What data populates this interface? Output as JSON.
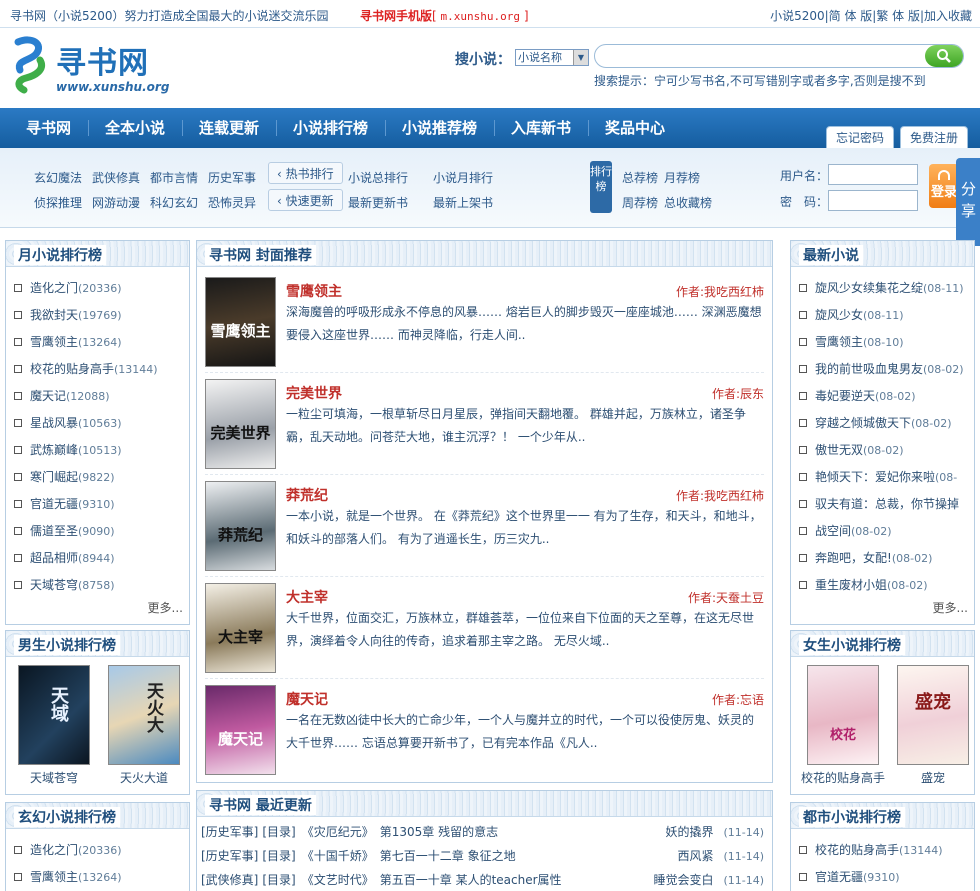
{
  "topbar": {
    "left": "寻书网（小说5200）努力打造成全国最大的小说迷交流乐园",
    "mobile_label": "寻书网手机版",
    "mobile_url": "m.xunshu.org",
    "right": "小说5200|简 体 版|繁 体 版|加入收藏"
  },
  "logo": {
    "name": "寻书网",
    "url": "www.xunshu.org"
  },
  "search": {
    "label": "搜小说：",
    "select": "小说名称",
    "button": "搜",
    "tip": "搜索提示：宁可少写书名,不可写错别字或者多字,否则是搜不到"
  },
  "nav": [
    "寻书网",
    "全本小说",
    "连载更新",
    "小说排行榜",
    "小说推荐榜",
    "入库新书",
    "奖品中心"
  ],
  "nav_tabs": [
    "忘记密码",
    "免费注册"
  ],
  "subnav": {
    "genres_row1": [
      "玄幻魔法",
      "武侠修真",
      "都市言情",
      "历史军事"
    ],
    "genres_row2": [
      "侦探推理",
      "网游动漫",
      "科幻玄幻",
      "恐怖灵异"
    ],
    "hot": "热书排行",
    "fast": "快速更新",
    "row1": [
      "小说总排行",
      "小说月排行"
    ],
    "row2": [
      "最新更新书",
      "最新上架书"
    ],
    "badge": "排行榜",
    "rank_row1": [
      "总荐榜",
      "月荐榜"
    ],
    "rank_row2": [
      "周荐榜",
      "总收藏榜"
    ]
  },
  "login": {
    "user_label": "用户名：",
    "pass_label": "密　码：",
    "button": "登录",
    "share": "分享"
  },
  "month_rank": {
    "title": "月小说排行榜",
    "items": [
      [
        "造化之门",
        "(20336)"
      ],
      [
        "我欲封天",
        "(19769)"
      ],
      [
        "雪鹰领主",
        "(13264)"
      ],
      [
        "校花的贴身高手",
        "(13144)"
      ],
      [
        "魔天记",
        "(12088)"
      ],
      [
        "星战风暴",
        "(10563)"
      ],
      [
        "武炼巅峰",
        "(10513)"
      ],
      [
        "寒门崛起",
        "(9822)"
      ],
      [
        "官道无疆",
        "(9310)"
      ],
      [
        "儒道至圣",
        "(9090)"
      ],
      [
        "超品相师",
        "(8944)"
      ],
      [
        "天域苍穹",
        "(8758)"
      ]
    ],
    "more": "更多..."
  },
  "male_rank": {
    "title": "男生小说排行榜",
    "books": [
      "天域苍穹",
      "天火大道"
    ]
  },
  "xuanhuan_rank": {
    "title": "玄幻小说排行榜",
    "items": [
      [
        "造化之门",
        "(20336)"
      ],
      [
        "雪鹰领主",
        "(13264)"
      ]
    ]
  },
  "featured": {
    "title": "寻书网 封面推荐",
    "books": [
      {
        "title": "雪鹰领主",
        "author": "作者:我吃西红柿",
        "desc": "深海魔兽的呼吸形成永不停息的风暴…… 熔岩巨人的脚步毁灭一座座城池…… 深渊恶魔想要侵入这座世界…… 而神灵降临，行走人间..",
        "cover": "雪鹰领主"
      },
      {
        "title": "完美世界",
        "author": "作者:辰东",
        "desc": "一粒尘可填海，一根草斩尽日月星辰，弹指间天翻地覆。 群雄并起，万族林立，诸圣争霸，乱天动地。问苍茫大地，谁主沉浮？！ 一个少年从..",
        "cover": "完美世界"
      },
      {
        "title": "莽荒纪",
        "author": "作者:我吃西红柿",
        "desc": "一本小说，就是一个世界。 在《莽荒纪》这个世界里一一 有为了生存，和天斗，和地斗，和妖斗的部落人们。 有为了逍遥长生，历三灾九..",
        "cover": "莽荒纪"
      },
      {
        "title": "大主宰",
        "author": "作者:天蚕土豆",
        "desc": "大千世界，位面交汇，万族林立，群雄荟萃，一位位来自下位面的天之至尊，在这无尽世界，演绎着令人向往的传奇，追求着那主宰之路。 无尽火域..",
        "cover": "大主宰"
      },
      {
        "title": "魔天记",
        "author": "作者:忘语",
        "desc": "一名在无数凶徒中长大的亡命少年，一个人与魔并立的时代，一个可以役使厉鬼、妖灵的大千世界…… 忘语总算要开新书了，已有完本作品《凡人..",
        "cover": "魔天记"
      }
    ]
  },
  "recent": {
    "title": "寻书网 最近更新",
    "rows": [
      {
        "cat": "[历史军事]",
        "dir": "[目录]",
        "book": "《灾厄纪元》",
        "chapter": "第1305章 残留的意志",
        "author": "妖的撬界",
        "date": "(11-14)"
      },
      {
        "cat": "[历史军事]",
        "dir": "[目录]",
        "book": "《十国千娇》",
        "chapter": "第七百一十二章 象征之地",
        "author": "西风紧",
        "date": "(11-14)"
      },
      {
        "cat": "[武侠修真]",
        "dir": "[目录]",
        "book": "《文艺时代》",
        "chapter": "第五百一十章 某人的teacher属性",
        "author": "睡觉会变白",
        "date": "(11-14)"
      }
    ]
  },
  "newest": {
    "title": "最新小说",
    "items": [
      [
        "旋风少女续集花之绽",
        "(08-11)"
      ],
      [
        "旋风少女",
        "(08-11)"
      ],
      [
        "雪鹰领主",
        "(08-10)"
      ],
      [
        "我的前世吸血鬼男友",
        "(08-02)"
      ],
      [
        "毒妃要逆天",
        "(08-02)"
      ],
      [
        "穿越之倾城傲天下",
        "(08-02)"
      ],
      [
        "傲世无双",
        "(08-02)"
      ],
      [
        "艳倾天下：爱妃你来啦",
        "(08-"
      ],
      [
        "驭夫有道：总裁，你节操掉",
        ""
      ],
      [
        "战空间",
        "(08-02)"
      ],
      [
        "奔跑吧，女配!",
        "(08-02)"
      ],
      [
        "重生废材小姐",
        "(08-02)"
      ]
    ],
    "more": "更多..."
  },
  "female_rank": {
    "title": "女生小说排行榜",
    "books": [
      "校花的贴身高手",
      "盛宠"
    ]
  },
  "urban_rank": {
    "title": "都市小说排行榜",
    "items": [
      [
        "校花的贴身高手",
        "(13144)"
      ],
      [
        "官道无疆",
        "(9310)"
      ]
    ]
  },
  "colors": {
    "nav": "#1d69b0",
    "title_red": "#c0302b",
    "link": "#2d4f73"
  }
}
